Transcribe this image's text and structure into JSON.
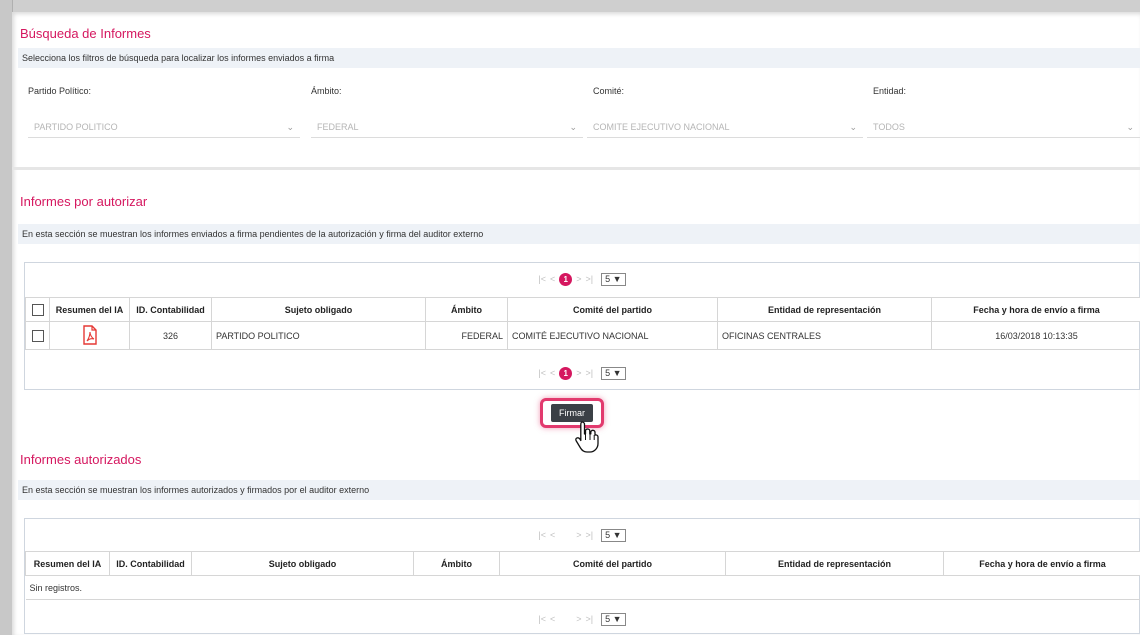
{
  "search": {
    "title": "Búsqueda de Informes",
    "instructions": "Selecciona los filtros de búsqueda para localizar los informes enviados a firma",
    "filters": [
      {
        "label": "Partido Político:",
        "value": "PARTIDO POLITICO"
      },
      {
        "label": "Ámbito:",
        "value": "FEDERAL"
      },
      {
        "label": "Comité:",
        "value": "COMITE EJECUTIVO NACIONAL"
      },
      {
        "label": "Entidad:",
        "value": "TODOS"
      }
    ]
  },
  "pending": {
    "title": "Informes por autorizar",
    "description": "En esta sección se muestran los informes enviados a firma pendientes de la autorización y firma del auditor externo",
    "pager": {
      "first": "|<",
      "prev": "<",
      "current": "1",
      "next": ">",
      "last": ">|",
      "page_size": "5"
    },
    "columns": [
      "Resumen del IA",
      "ID. Contabilidad",
      "Sujeto obligado",
      "Ámbito",
      "Comité del partido",
      "Entidad de representación",
      "Fecha y hora de envío a firma"
    ],
    "rows": [
      {
        "id": "326",
        "sujeto": "PARTIDO POLITICO",
        "ambito": "FEDERAL",
        "comite": "COMITÉ EJECUTIVO NACIONAL",
        "entidad": "OFICINAS CENTRALES",
        "fecha": "16/03/2018 10:13:35"
      }
    ],
    "sign_button": "Firmar"
  },
  "authorized": {
    "title": "Informes autorizados",
    "description": "En esta sección se muestran los informes autorizados y firmados por el auditor externo",
    "pager": {
      "first": "|<",
      "prev": "<",
      "next": ">",
      "last": ">|",
      "page_size": "5"
    },
    "columns": [
      "Resumen del IA",
      "ID. Contabilidad",
      "Sujeto obligado",
      "Ámbito",
      "Comité del partido",
      "Entidad de representación",
      "Fecha y hora de envío a firma"
    ],
    "empty_text": "Sin registros."
  },
  "colors": {
    "accent": "#d5175f",
    "band": "#eef2f7",
    "button": "#3b4046"
  }
}
